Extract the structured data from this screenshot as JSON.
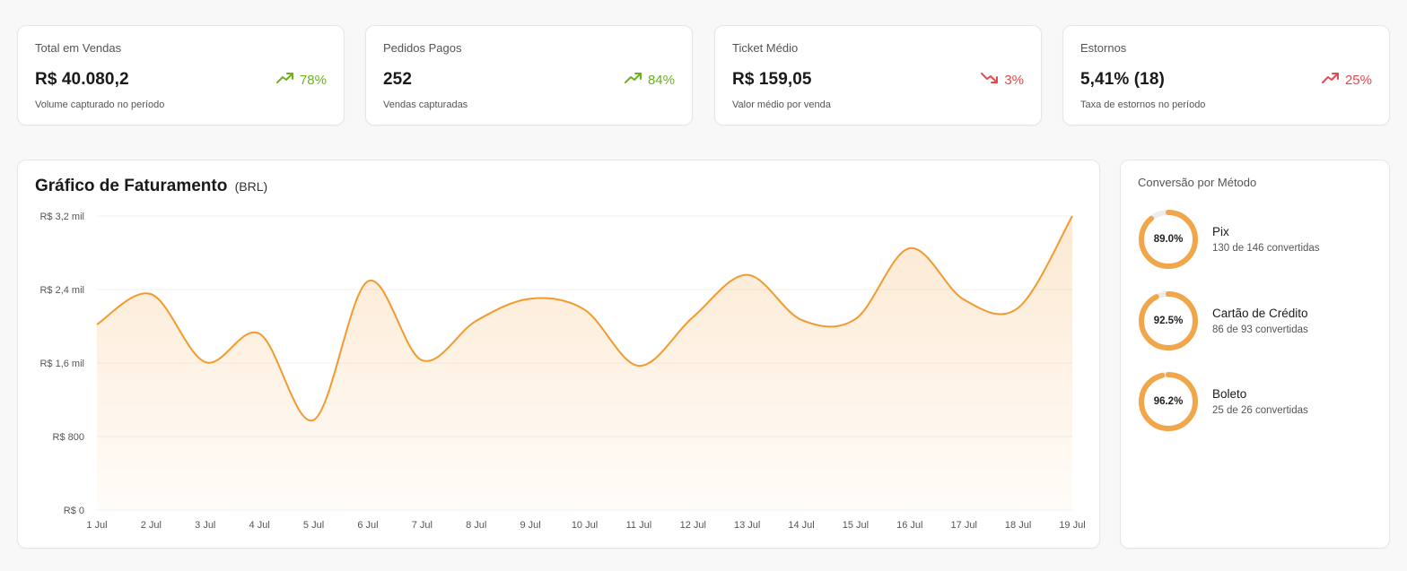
{
  "kpis": [
    {
      "label": "Total em Vendas",
      "value": "R$ 40.080,2",
      "trend": "78%",
      "trend_dir": "up",
      "sentiment": "good",
      "sub": "Volume capturado no período"
    },
    {
      "label": "Pedidos Pagos",
      "value": "252",
      "trend": "84%",
      "trend_dir": "up",
      "sentiment": "good",
      "sub": "Vendas capturadas"
    },
    {
      "label": "Ticket Médio",
      "value": "R$ 159,05",
      "trend": "3%",
      "trend_dir": "down",
      "sentiment": "bad",
      "sub": "Valor médio por venda"
    },
    {
      "label": "Estornos",
      "value": "5,41% (18)",
      "trend": "25%",
      "trend_dir": "up",
      "sentiment": "bad",
      "sub": "Taxa de estornos no período"
    }
  ],
  "colors": {
    "accent": "#f29a2e",
    "good": "#6ab21e",
    "bad": "#e5484d",
    "track": "#ececec"
  },
  "icons": {
    "up": "trending-up-icon",
    "down": "trending-down-icon"
  },
  "chart": {
    "title": "Gráfico de Faturamento",
    "unit": "(BRL)"
  },
  "chart_data": {
    "type": "area",
    "title": "Gráfico de Faturamento (BRL)",
    "categories": [
      "1 Jul",
      "2 Jul",
      "3 Jul",
      "4 Jul",
      "5 Jul",
      "6 Jul",
      "7 Jul",
      "8 Jul",
      "9 Jul",
      "10 Jul",
      "11 Jul",
      "12 Jul",
      "13 Jul",
      "14 Jul",
      "15 Jul",
      "16 Jul",
      "17 Jul",
      "18 Jul",
      "19 Jul"
    ],
    "values": [
      2020,
      2350,
      1610,
      1920,
      980,
      2490,
      1630,
      2060,
      2300,
      2180,
      1570,
      2100,
      2560,
      2070,
      2080,
      2850,
      2290,
      2200,
      3200
    ],
    "ylim": [
      0,
      3200
    ],
    "yticks": [
      0,
      800,
      1600,
      2400,
      3200
    ],
    "ytick_labels": [
      "R$ 0",
      "R$ 800",
      "R$ 1,6 mil",
      "R$ 2,4 mil",
      "R$ 3,2 mil"
    ],
    "grid": true,
    "xlabel": "",
    "ylabel": ""
  },
  "conversion": {
    "title": "Conversão por Método",
    "methods": [
      {
        "name": "Pix",
        "pct_label": "89.0%",
        "pct": 0.89,
        "detail": "130 de 146 convertidas"
      },
      {
        "name": "Cartão de Crédito",
        "pct_label": "92.5%",
        "pct": 0.925,
        "detail": "86 de 93 convertidas"
      },
      {
        "name": "Boleto",
        "pct_label": "96.2%",
        "pct": 0.962,
        "detail": "25 de 26 convertidas"
      }
    ]
  }
}
